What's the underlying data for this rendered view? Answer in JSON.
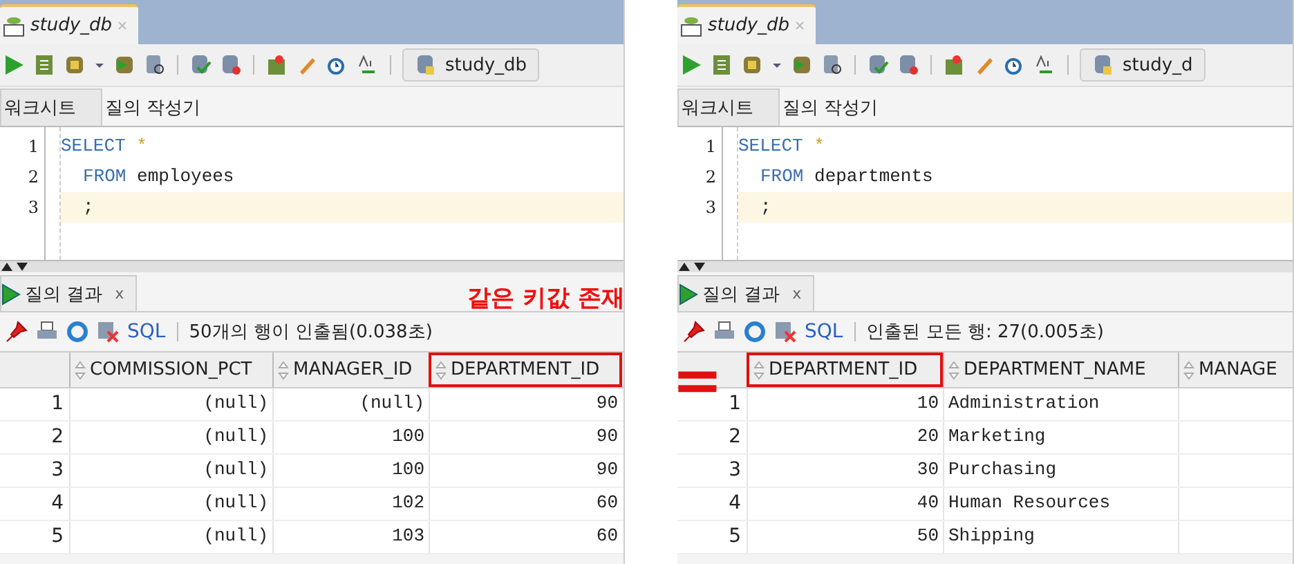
{
  "panels": [
    {
      "tab_title": "study_db",
      "connection": "study_db",
      "editor_tabs": [
        {
          "label": "워크시트",
          "selected": true
        },
        {
          "label": "질의 작성기",
          "selected": false
        }
      ],
      "code": [
        {
          "number": "1",
          "keyword": "SELECT",
          "text": "*",
          "indented": false,
          "current": false
        },
        {
          "number": "2",
          "keyword": "FROM",
          "text": "employees",
          "indented": true,
          "current": false
        },
        {
          "number": "3",
          "text": ";",
          "indented": true,
          "current": true
        }
      ],
      "results_tab": "질의 결과",
      "results_close": "x",
      "sql_link": "SQL",
      "status": "50개의 행이 인출됨(0.038초)",
      "columns": [
        {
          "label": "COMMISSION_PCT",
          "kind": "number",
          "highlighted": false
        },
        {
          "label": "MANAGER_ID",
          "kind": "number",
          "highlighted": false
        },
        {
          "label": "DEPARTMENT_ID",
          "kind": "number",
          "highlighted": true
        }
      ],
      "rows": [
        {
          "number": "1",
          "cells": [
            "(null)",
            "(null)",
            "90"
          ]
        },
        {
          "number": "2",
          "cells": [
            "(null)",
            "100",
            "90"
          ]
        },
        {
          "number": "3",
          "cells": [
            "(null)",
            "100",
            "90"
          ]
        },
        {
          "number": "4",
          "cells": [
            "(null)",
            "102",
            "60"
          ]
        },
        {
          "number": "5",
          "cells": [
            "(null)",
            "103",
            "60"
          ]
        }
      ]
    },
    {
      "tab_title": "study_db",
      "connection": "study_d",
      "editor_tabs": [
        {
          "label": "워크시트",
          "selected": true
        },
        {
          "label": "질의 작성기",
          "selected": false
        }
      ],
      "code": [
        {
          "number": "1",
          "keyword": "SELECT",
          "text": "*",
          "indented": false,
          "current": false
        },
        {
          "number": "2",
          "keyword": "FROM",
          "text": "departments",
          "indented": true,
          "current": false
        },
        {
          "number": "3",
          "text": ";",
          "indented": true,
          "current": true
        }
      ],
      "results_tab": "질의 결과",
      "results_close": "x",
      "sql_link": "SQL",
      "status": "인출된 모든 행: 27(0.005초)",
      "columns": [
        {
          "label": "DEPARTMENT_ID",
          "kind": "number",
          "highlighted": true
        },
        {
          "label": "DEPARTMENT_NAME",
          "kind": "text",
          "highlighted": false
        },
        {
          "label": "MANAGE",
          "kind": "text",
          "highlighted": false
        }
      ],
      "rows": [
        {
          "number": "1",
          "cells": [
            "10",
            "Administration"
          ]
        },
        {
          "number": "2",
          "cells": [
            "20",
            "Marketing"
          ]
        },
        {
          "number": "3",
          "cells": [
            "30",
            "Purchasing"
          ]
        },
        {
          "number": "4",
          "cells": [
            "40",
            "Human Resources"
          ]
        },
        {
          "number": "5",
          "cells": [
            "50",
            "Shipping"
          ]
        }
      ]
    }
  ],
  "annotation": {
    "text": "같은 키값 존재",
    "equals": "="
  }
}
